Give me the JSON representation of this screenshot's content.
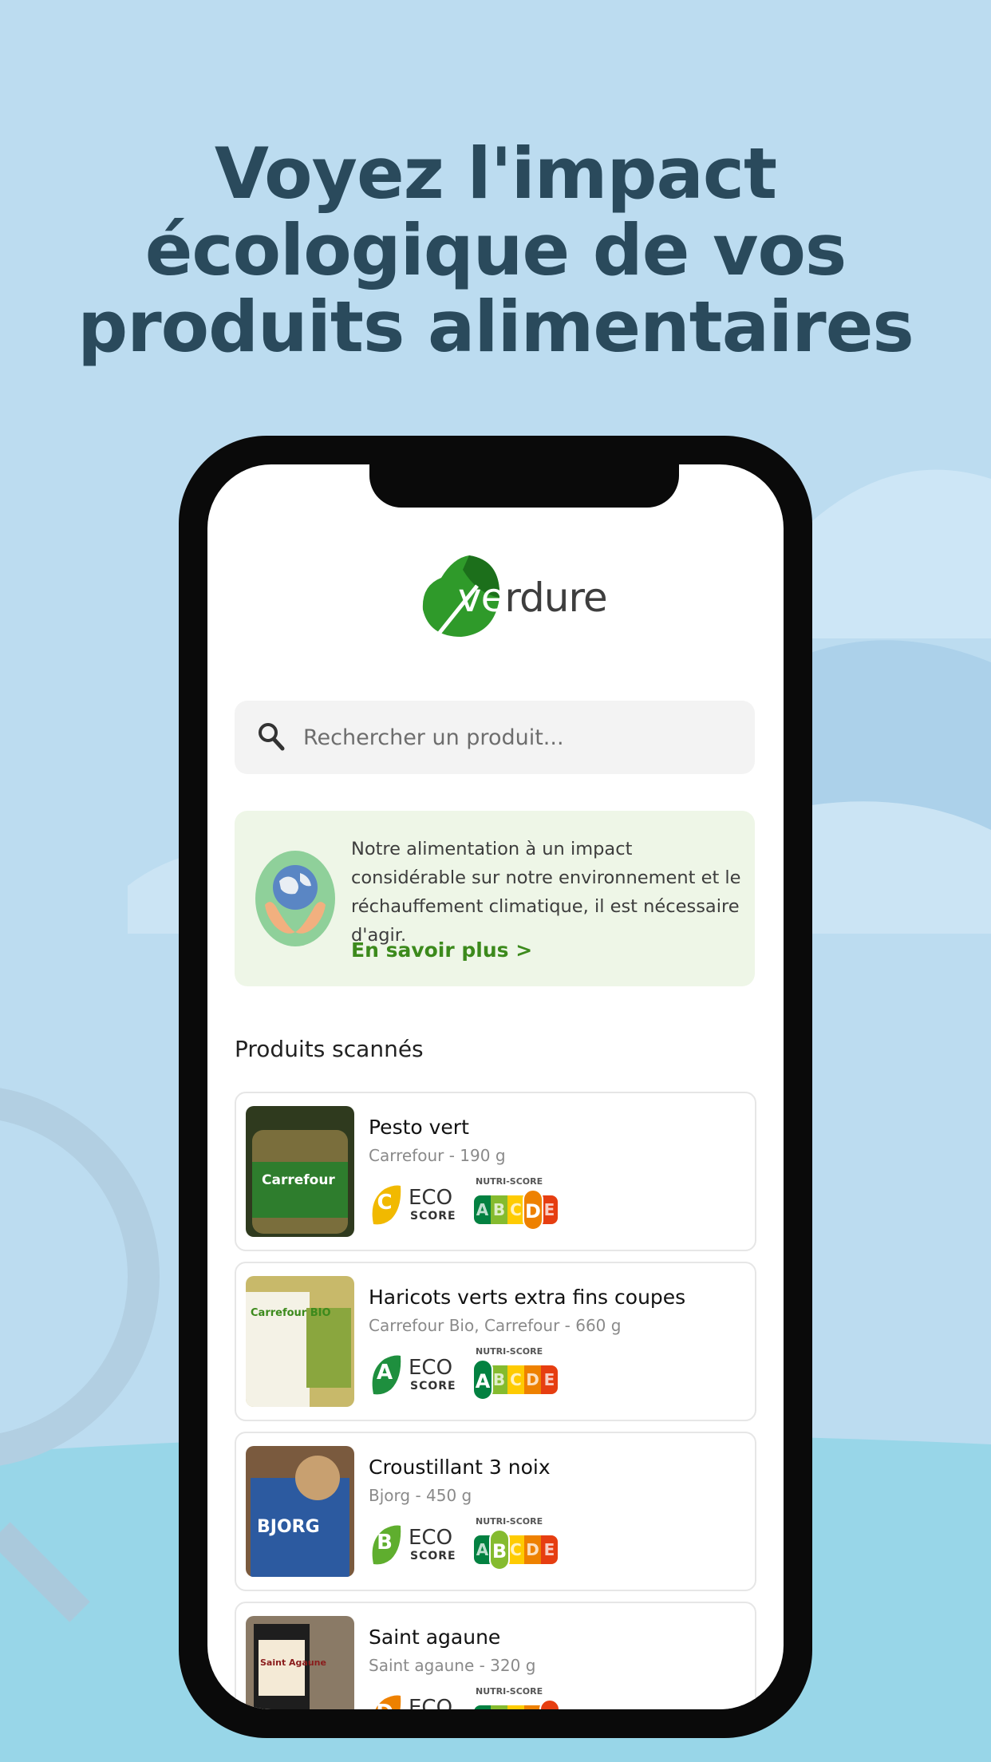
{
  "headline": [
    "Voyez l'impact",
    "écologique de vos",
    "produits alimentaires"
  ],
  "app": {
    "logo_prefix": "v",
    "logo_suffix": "rdure",
    "logo_letter_e": "e"
  },
  "search": {
    "placeholder": "Rechercher un produit..."
  },
  "info": {
    "text": "Notre alimentation à un impact considérable sur notre environnement et le réchauffement climatique, il est nécessaire d'agir.",
    "link": "En savoir plus >"
  },
  "section_title": "Produits scannés",
  "eco_word1": "ECO",
  "eco_word2": "SCORE",
  "nutri_title": "NUTRI-SCORE",
  "nutri_letters": [
    "A",
    "B",
    "C",
    "D",
    "E"
  ],
  "products": [
    {
      "name": "Pesto vert",
      "sub": "Carrefour - 190 g",
      "eco": "C",
      "eco_color": "#f1b900",
      "nutri": "D",
      "thumb_label": "Carrefour"
    },
    {
      "name": "Haricots verts extra fins coupes",
      "sub": "Carrefour Bio, Carrefour - 660 g",
      "eco": "A",
      "eco_color": "#1e8f3e",
      "nutri": "A",
      "thumb_label": "Carrefour BIO"
    },
    {
      "name": "Croustillant 3 noix",
      "sub": "Bjorg - 450 g",
      "eco": "B",
      "eco_color": "#5fae2e",
      "nutri": "B",
      "thumb_label": "BJORG"
    },
    {
      "name": "Saint agaune",
      "sub": "Saint agaune - 320 g",
      "eco": "D",
      "eco_color": "#ee8100",
      "nutri": "E",
      "thumb_label": "Saint Agaune"
    }
  ],
  "colors": {
    "background": "#bcdcf0",
    "headline": "#2a4a5c",
    "brand_green": "#3c8a1c",
    "info_bg": "#eef6e7"
  }
}
